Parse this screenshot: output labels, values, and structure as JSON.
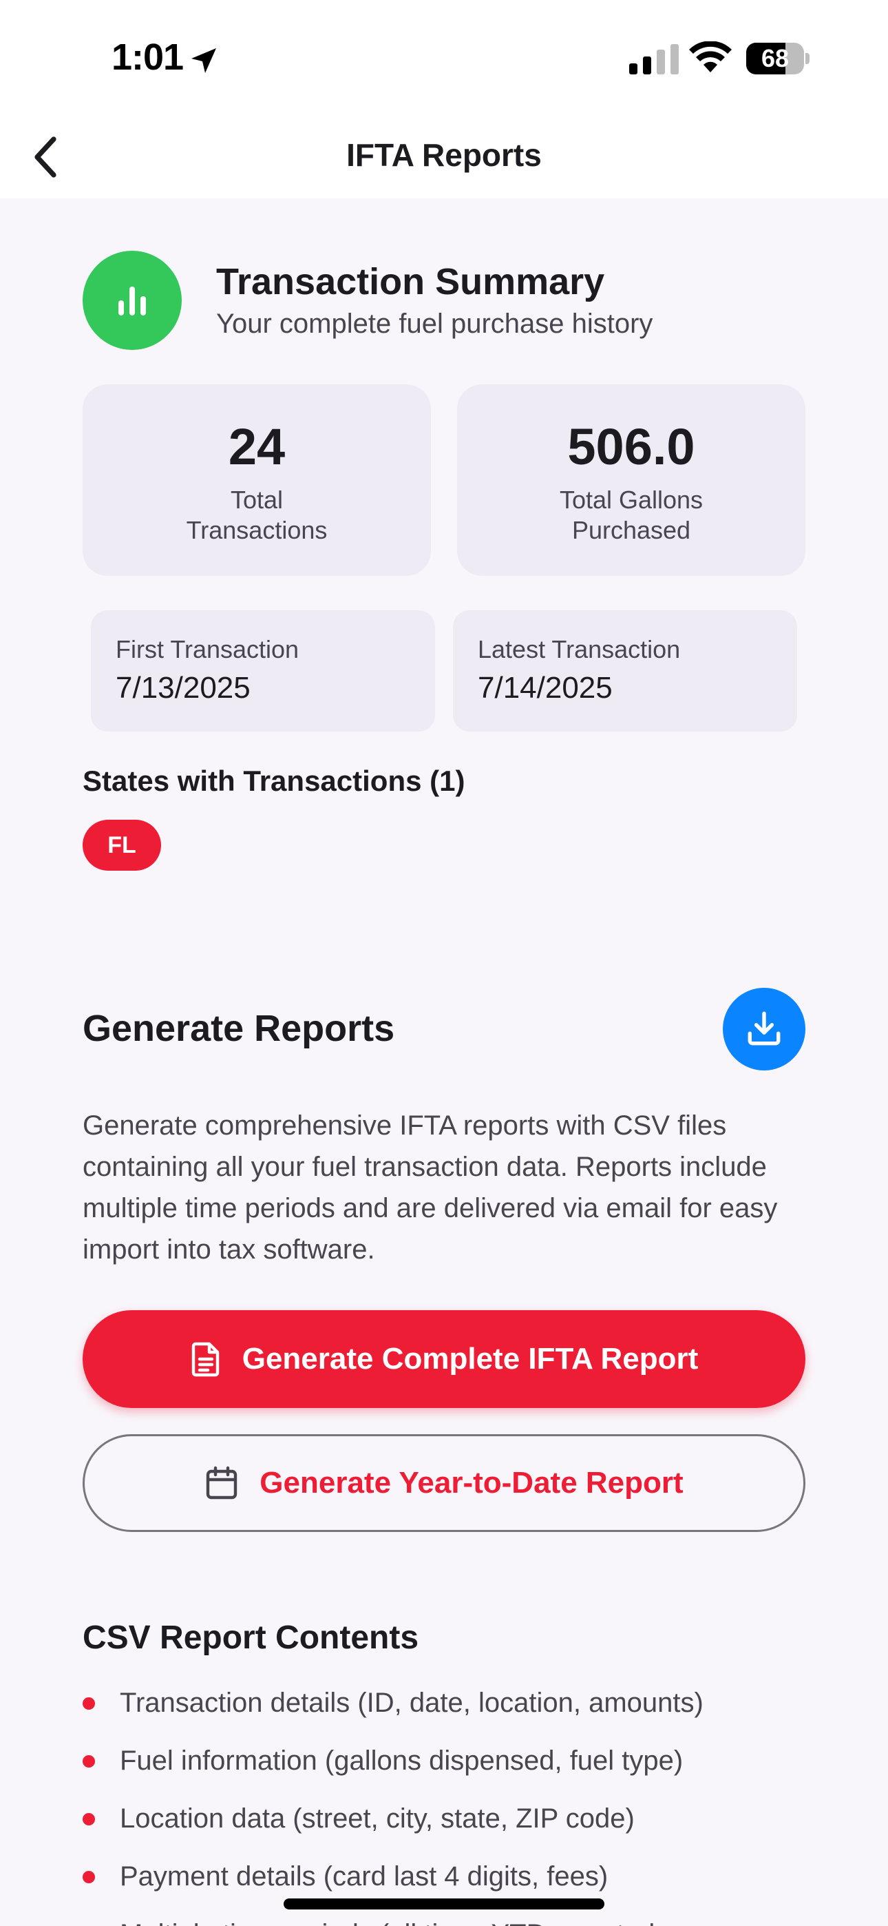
{
  "status_bar": {
    "time": "1:01",
    "battery": "68",
    "battery_level": 0.68
  },
  "nav": {
    "back_icon": "chevron-left-icon",
    "title": "IFTA Reports"
  },
  "summary": {
    "icon": "bar-chart-icon",
    "title": "Transaction Summary",
    "subtitle": "Your complete fuel purchase history",
    "total_transactions": {
      "value": "24",
      "label": "Total\nTransactions"
    },
    "total_gallons": {
      "value": "506.0",
      "label": "Total Gallons\nPurchased"
    },
    "first_transaction": {
      "label": "First Transaction",
      "value": "7/13/2025"
    },
    "latest_transaction": {
      "label": "Latest Transaction",
      "value": "7/14/2025"
    },
    "states_title": "States with Transactions (1)",
    "states": [
      "FL"
    ]
  },
  "generate": {
    "title": "Generate Reports",
    "download_icon": "download-icon",
    "description": "Generate comprehensive IFTA reports with CSV files containing all your fuel transaction data. Reports include multiple time periods and are delivered via email for easy import into tax software.",
    "primary_button": "Generate Complete IFTA Report",
    "secondary_button": "Generate Year-to-Date Report"
  },
  "csv": {
    "title": "CSV Report Contents",
    "items": [
      "Transaction details (ID, date, location, amounts)",
      "Fuel information (gallons dispensed, fuel type)",
      "Location data (street, city, state, ZIP code)",
      "Payment details (card last 4 digits, fees)",
      "Multiple time periods (all time, YTD, quarterly"
    ]
  },
  "colors": {
    "accent_red": "#EE1D36",
    "accent_green": "#34C759",
    "accent_blue": "#0A84FF",
    "background": "#F8F6FB",
    "card": "#EFEBF4"
  }
}
